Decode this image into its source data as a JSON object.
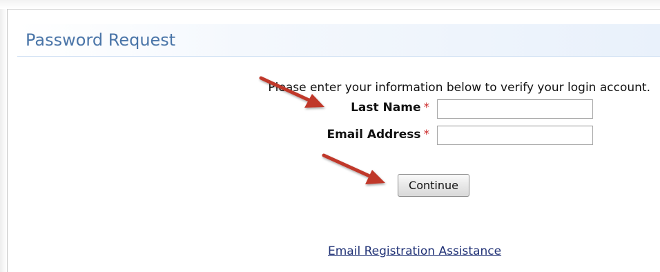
{
  "page": {
    "title": "Password Request",
    "instructions": "Please enter your information below to verify your login account."
  },
  "form": {
    "last_name_label": "Last Name",
    "email_label": "Email Address",
    "required_marker": "*",
    "last_name_value": "",
    "email_value": "",
    "continue_label": "Continue"
  },
  "links": {
    "assistance": "Email Registration Assistance"
  },
  "colors": {
    "title": "#4a75a8",
    "required": "#cc2b2b",
    "annotation_arrow": "#c0392b",
    "link": "#223377"
  },
  "annotations": [
    {
      "icon": "arrow-icon",
      "points_to": "last-name-field"
    },
    {
      "icon": "arrow-icon",
      "points_to": "continue-button"
    }
  ]
}
